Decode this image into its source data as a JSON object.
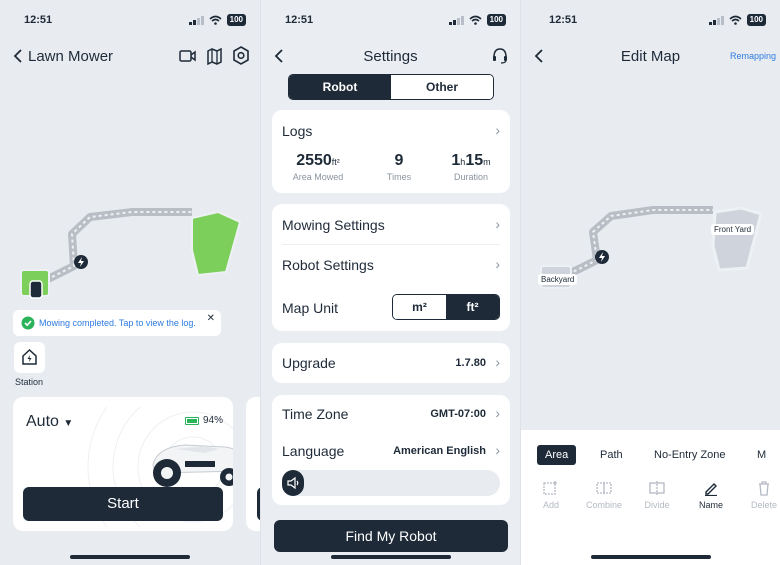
{
  "status": {
    "time": "12:51",
    "battery": "100"
  },
  "p1": {
    "title": "Lawn Mower",
    "toast": "Mowing completed. Tap to view the log.",
    "station_label": "Station",
    "mode": "Auto",
    "battery_pct": "94%",
    "start_label": "Start"
  },
  "p2": {
    "title": "Settings",
    "tabs": {
      "robot": "Robot",
      "other": "Other"
    },
    "logs": {
      "label": "Logs",
      "area": {
        "value": "2550",
        "unit": "ft²",
        "label": "Area Mowed"
      },
      "times": {
        "value": "9",
        "label": "Times"
      },
      "duration": {
        "h": "1",
        "h_unit": "h",
        "m": "15",
        "m_unit": "m",
        "label": "Duration"
      }
    },
    "mowing_settings": "Mowing Settings",
    "robot_settings": "Robot Settings",
    "map_unit": {
      "label": "Map Unit",
      "options": [
        "m²",
        "ft²"
      ],
      "selected": "ft²"
    },
    "upgrade": {
      "label": "Upgrade",
      "version": "1.7.80"
    },
    "time_zone": {
      "label": "Time Zone",
      "value": "GMT-07:00"
    },
    "language": {
      "label": "Language",
      "value": "American English"
    },
    "find_robot": "Find My Robot"
  },
  "p3": {
    "title": "Edit Map",
    "remapping": "Remapping",
    "zone_labels": {
      "front": "Front Yard",
      "back": "Backyard"
    },
    "tabs": [
      "Area",
      "Path",
      "No-Entry Zone",
      "M"
    ],
    "tools": {
      "add": "Add",
      "combine": "Combine",
      "divide": "Divide",
      "name": "Name",
      "delete": "Delete"
    }
  },
  "colors": {
    "dark": "#1e2a38",
    "green": "#7ccf5a",
    "accent": "#2f7be0",
    "success": "#2bb35a"
  }
}
